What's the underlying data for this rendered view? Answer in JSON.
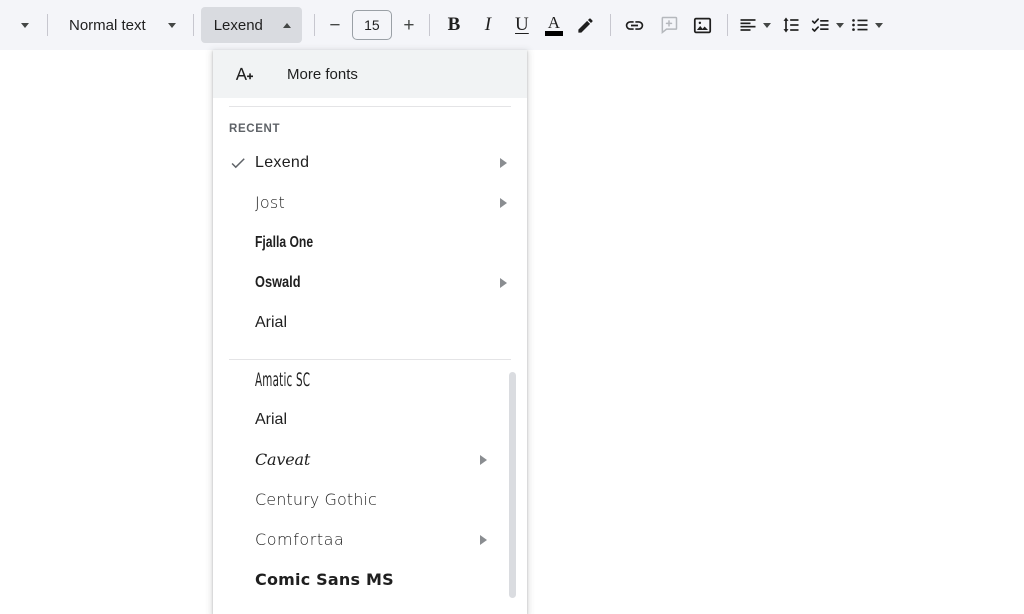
{
  "toolbar": {
    "collapse_icon": "chevron-down-icon",
    "paragraph_style": {
      "label": "Normal text",
      "caret": "chevron-down-icon"
    },
    "font": {
      "label": "Lexend",
      "caret": "chevron-up-icon",
      "active": true
    },
    "font_size": {
      "decrease": "−",
      "value": "15",
      "increase": "+"
    },
    "buttons": [
      {
        "name": "bold-button",
        "glyph": "B"
      },
      {
        "name": "italic-button",
        "glyph": "I"
      },
      {
        "name": "underline-button",
        "glyph": "U"
      },
      {
        "name": "text-color-button",
        "glyph": "A"
      },
      {
        "name": "highlight-color-button",
        "glyph": "pen-icon"
      },
      {
        "name": "insert-link-button",
        "glyph": "link-icon"
      },
      {
        "name": "add-comment-button",
        "glyph": "comment-plus-icon"
      },
      {
        "name": "insert-image-button",
        "glyph": "image-icon"
      },
      {
        "name": "align-button",
        "glyph": "align-left-icon"
      },
      {
        "name": "line-spacing-button",
        "glyph": "line-spacing-icon"
      },
      {
        "name": "checklist-button",
        "glyph": "checklist-icon"
      },
      {
        "name": "bulleted-list-button",
        "glyph": "bulleted-list-icon"
      }
    ]
  },
  "font_menu": {
    "more_fonts": {
      "label": "More fonts",
      "icon": "a-plus-icon"
    },
    "recent_header": "RECENT",
    "recent_fonts": [
      {
        "label": "Lexend",
        "selected": true,
        "has_submenu": true,
        "style": "f-lexend"
      },
      {
        "label": "Jost",
        "selected": false,
        "has_submenu": true,
        "style": "f-jost"
      },
      {
        "label": "Fjalla One",
        "selected": false,
        "has_submenu": false,
        "style": "f-fjalla"
      },
      {
        "label": "Oswald",
        "selected": false,
        "has_submenu": true,
        "style": "f-oswald"
      },
      {
        "label": "Arial",
        "selected": false,
        "has_submenu": false,
        "style": "f-arial"
      }
    ],
    "all_fonts": [
      {
        "label": "Amatic SC",
        "has_submenu": false,
        "style": "f-amatic"
      },
      {
        "label": "Arial",
        "has_submenu": false,
        "style": "f-arial"
      },
      {
        "label": "Caveat",
        "has_submenu": true,
        "style": "f-caveat"
      },
      {
        "label": "Century Gothic",
        "has_submenu": false,
        "style": "f-century"
      },
      {
        "label": "Comfortaa",
        "has_submenu": true,
        "style": "f-comfortaa"
      },
      {
        "label": "Comic Sans MS",
        "has_submenu": false,
        "style": "f-comic"
      }
    ],
    "checkmark": "✓"
  },
  "colors": {
    "toolbar_bg": "#f4f5f9",
    "active_button_bg": "#d9dbe0",
    "menu_hover_bg": "#f1f3f4",
    "text": "#1f1f1f",
    "muted_text": "#5f6368",
    "scrollbar": "#dadce0"
  }
}
